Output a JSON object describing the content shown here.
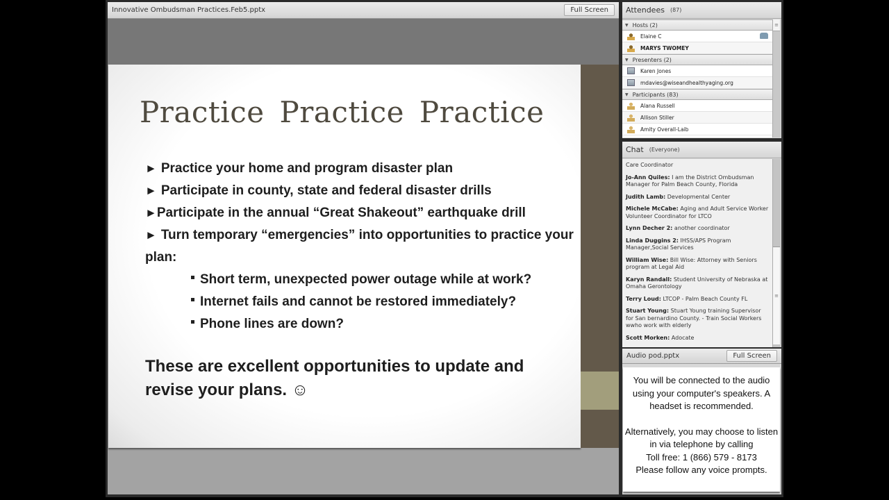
{
  "share_pod": {
    "title": "Innovative Ombudsman Practices.Feb5.pptx",
    "fullscreen_label": "Full Screen",
    "slide": {
      "title": "Practice  Practice   Practice",
      "bullets": [
        "Practice your home and program disaster plan",
        "Participate in county, state and federal disaster drills",
        "Participate in the annual “Great Shakeout” earthquake drill",
        "Turn temporary “emergencies” into opportunities to practice your plan:"
      ],
      "bullet_marker": "►",
      "sub_bullets": [
        "Short term, unexpected power outage while at work?",
        "Internet fails and cannot be restored immediately?",
        "Phone lines are down?"
      ],
      "closing": "These are excellent opportunities to update and revise your plans. ☺"
    }
  },
  "attendees": {
    "title": "Attendees",
    "count": "(87)",
    "groups": [
      {
        "label": "Hosts (2)",
        "members": [
          {
            "name": "Elaine C",
            "icon": "host-icon",
            "phone": true
          },
          {
            "name": "MARYS TWOMEY",
            "icon": "host-icon",
            "phone": false
          }
        ]
      },
      {
        "label": "Presenters (2)",
        "members": [
          {
            "name": "Karen Jones",
            "icon": "presenter-icon"
          },
          {
            "name": "mdavies@wiseandhealthyaging.org",
            "icon": "presenter-icon"
          }
        ]
      },
      {
        "label": "Participants (83)",
        "members": [
          {
            "name": "Alana Russell",
            "icon": "participant-icon"
          },
          {
            "name": "Allison Stiller",
            "icon": "participant-icon"
          },
          {
            "name": "Amity Overall-Laib",
            "icon": "participant-icon"
          }
        ]
      }
    ]
  },
  "chat": {
    "title": "Chat",
    "scope": "(Everyone)",
    "messages": [
      {
        "author": "",
        "text": "Care Coordinator"
      },
      {
        "author": "Jo-Ann Quiles:",
        "text": " I am the District Ombudsman Manager for Palm Beach County, Florida"
      },
      {
        "author": "Judith Lamb:",
        "text": " Developmental Center"
      },
      {
        "author": "Michele McCabe:",
        "text": " Aging and Adult Service Worker Volunteer Coordinator for LTCO"
      },
      {
        "author": "Lynn Decher 2:",
        "text": " another coordinator"
      },
      {
        "author": "Linda Duggins 2:",
        "text": " IHSS/APS Program Manager,Social Services"
      },
      {
        "author": "William Wise:",
        "text": " Bill Wise:  Attorney with Seniors program at Legal Aid"
      },
      {
        "author": "Karyn Randall:",
        "text": " Student University of Nebraska at Omaha Gerontology"
      },
      {
        "author": "Terry Loud:",
        "text": " LTCOP - Palm Beach County FL"
      },
      {
        "author": "Stuart Young:",
        "text": " Stuart Young training Supervisor for San bernardino County. - Train Social Workers wwho work with elderly"
      },
      {
        "author": "Scott Morken:",
        "text": " Adocate"
      }
    ]
  },
  "audio_pod": {
    "title": "Audio pod.pptx",
    "fullscreen_label": "Full Screen",
    "paragraph1": "You will be connected to the audio using your computer's speakers. A headset is recommended.",
    "paragraph2_lines": [
      "Alternatively, you may choose to listen in via telephone by calling",
      "Toll free: 1 (866) 579 - 8173",
      "Please follow any voice prompts."
    ]
  }
}
